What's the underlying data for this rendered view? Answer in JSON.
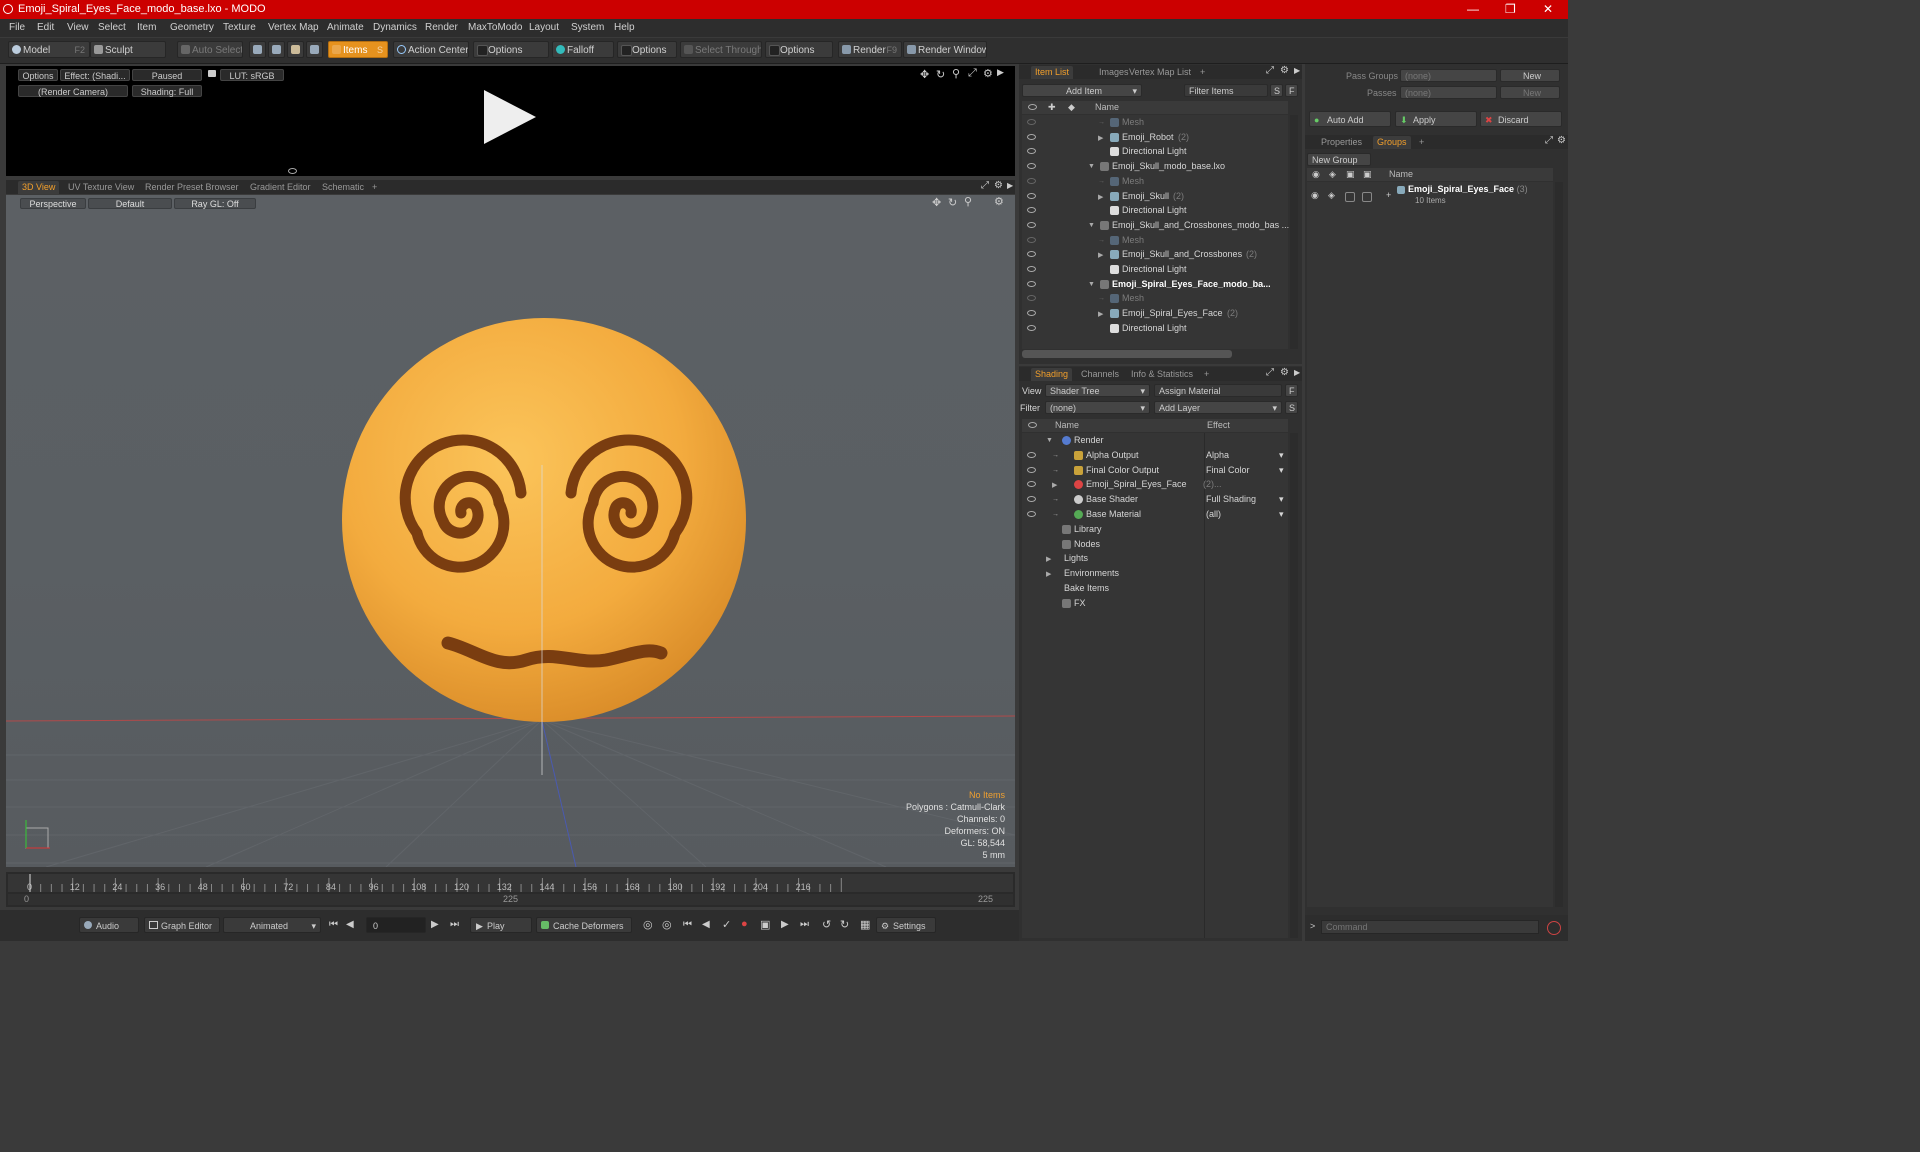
{
  "window": {
    "title": "Emoji_Spiral_Eyes_Face_modo_base.lxo - MODO"
  },
  "menu": [
    "File",
    "Edit",
    "View",
    "Select",
    "Item",
    "Geometry",
    "Texture",
    "Vertex Map",
    "Animate",
    "Dynamics",
    "Render",
    "MaxToModo",
    "Layout",
    "System",
    "Help"
  ],
  "toolbar": {
    "model": "Model",
    "model_key": "F2",
    "sculpt": "Sculpt",
    "auto_select": "Auto Select",
    "items": "Items",
    "items_key": "S",
    "action_center": "Action Center",
    "options1": "Options",
    "falloff": "Falloff",
    "options2": "Options",
    "select_through": "Select Through",
    "options3": "Options",
    "render": "Render",
    "render_key": "F9",
    "render_window": "Render Window"
  },
  "preview": {
    "options": "Options",
    "effect": "Effect: (Shadi...",
    "paused": "Paused",
    "lut": "LUT: sRGB",
    "camera": "(Render Camera)",
    "shading": "Shading: Full"
  },
  "view_tabs": [
    "3D View",
    "UV Texture View",
    "Render Preset Browser",
    "Gradient Editor",
    "Schematic",
    "+"
  ],
  "viewport": {
    "perspective": "Perspective",
    "default": "Default",
    "raygl": "Ray GL: Off",
    "stats": [
      "No Items",
      "Polygons : Catmull-Clark",
      "Channels: 0",
      "Deformers: ON",
      "GL: 58,544",
      "5 mm"
    ]
  },
  "timeline": {
    "ticks": [
      "0",
      "12",
      "24",
      "36",
      "48",
      "60",
      "72",
      "84",
      "96",
      "108",
      "120",
      "132",
      "144",
      "156",
      "168",
      "180",
      "192",
      "204",
      "216"
    ],
    "range_start": "0",
    "range_mid": "225",
    "range_end": "225"
  },
  "bottombar": {
    "audio": "Audio",
    "graph_editor": "Graph Editor",
    "animated": "Animated",
    "frame": "0",
    "play": "Play",
    "cache": "Cache Deformers",
    "settings": "Settings"
  },
  "item_list": {
    "tabs": [
      "Item List",
      "Images",
      "Vertex Map List",
      "+"
    ],
    "add_item": "Add Item",
    "filter_items": "Filter Items",
    "s": "S",
    "f": "F",
    "col_name": "Name",
    "rows": [
      {
        "label": "Mesh",
        "dim": true,
        "indent": 2
      },
      {
        "label": "Emoji_Robot",
        "count": "(2)",
        "indent": 2
      },
      {
        "label": "Directional Light",
        "indent": 2
      },
      {
        "label": "Emoji_Skull_modo_base.lxo",
        "indent": 1
      },
      {
        "label": "Mesh",
        "dim": true,
        "indent": 2
      },
      {
        "label": "Emoji_Skull",
        "count": "(2)",
        "indent": 2
      },
      {
        "label": "Directional Light",
        "indent": 2
      },
      {
        "label": "Emoji_Skull_and_Crossbones_modo_bas ...",
        "indent": 1
      },
      {
        "label": "Mesh",
        "dim": true,
        "indent": 2
      },
      {
        "label": "Emoji_Skull_and_Crossbones",
        "count": "(2)",
        "indent": 2
      },
      {
        "label": "Directional Light",
        "indent": 2
      },
      {
        "label": "Emoji_Spiral_Eyes_Face_modo_ba...",
        "indent": 1,
        "bold": true
      },
      {
        "label": "Mesh",
        "dim": true,
        "indent": 2
      },
      {
        "label": "Emoji_Spiral_Eyes_Face",
        "count": "(2)",
        "indent": 2
      },
      {
        "label": "Directional Light",
        "indent": 2
      }
    ]
  },
  "shading": {
    "tabs": [
      "Shading",
      "Channels",
      "Info & Statistics",
      "+"
    ],
    "view_label": "View",
    "view_value": "Shader Tree",
    "assign_material": "Assign Material",
    "filter_label": "Filter",
    "filter_value": "(none)",
    "add_layer": "Add Layer",
    "col_name": "Name",
    "col_effect": "Effect",
    "rows": [
      {
        "label": "Render",
        "effect": "",
        "indent": 0
      },
      {
        "label": "Alpha Output",
        "effect": "Alpha",
        "indent": 1
      },
      {
        "label": "Final Color Output",
        "effect": "Final Color",
        "indent": 1
      },
      {
        "label": "Emoji_Spiral_Eyes_Face",
        "count": "(2)...",
        "effect": "",
        "indent": 1
      },
      {
        "label": "Base Shader",
        "effect": "Full Shading",
        "indent": 1
      },
      {
        "label": "Base Material",
        "effect": "(all)",
        "indent": 1
      },
      {
        "label": "Library",
        "effect": "",
        "indent": 0
      },
      {
        "label": "Nodes",
        "effect": "",
        "indent": 0
      },
      {
        "label": "Lights",
        "effect": "",
        "indent": -1
      },
      {
        "label": "Environments",
        "effect": "",
        "indent": -1
      },
      {
        "label": "Bake Items",
        "effect": "",
        "indent": -1
      },
      {
        "label": "FX",
        "effect": "",
        "indent": 0
      }
    ]
  },
  "pass_panel": {
    "pass_groups": "Pass Groups",
    "passes": "Passes",
    "none": "(none)",
    "new": "New",
    "auto_add": "Auto Add",
    "apply": "Apply",
    "discard": "Discard"
  },
  "groups": {
    "tabs": [
      "Properties",
      "Groups",
      "+"
    ],
    "new_group": "New Group",
    "col_name": "Name",
    "item": "Emoji_Spiral_Eyes_Face",
    "count": "(3)",
    "sub": "10 Items"
  },
  "command": {
    "placeholder": "Command"
  }
}
